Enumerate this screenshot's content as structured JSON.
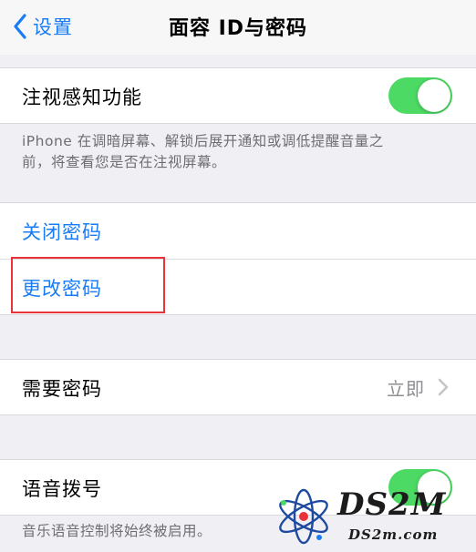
{
  "nav": {
    "back_label": "设置",
    "title": "面容 ID与密码"
  },
  "attention": {
    "label": "注视感知功能",
    "enabled": true,
    "footnote_line1": "iPhone 在调暗屏幕、解锁后展开通知或调低提醒音量之",
    "footnote_line2": "前，将查看您是否在注视屏幕。"
  },
  "passcode": {
    "turn_off_label": "关闭密码",
    "change_label": "更改密码"
  },
  "require_passcode": {
    "label": "需要密码",
    "value": "立即"
  },
  "voice_dial": {
    "label": "语音拨号",
    "enabled": true,
    "footnote": "音乐语音控制将始终被启用。"
  },
  "watermark": {
    "brand": "DS2M",
    "domain": "DS2m.com"
  },
  "colors": {
    "accent": "#1a7cf5",
    "toggle_on": "#4cd964",
    "highlight_box": "#e8333a"
  },
  "icons": [
    "chevron-left-icon",
    "chevron-right-icon",
    "atom-logo-icon"
  ]
}
